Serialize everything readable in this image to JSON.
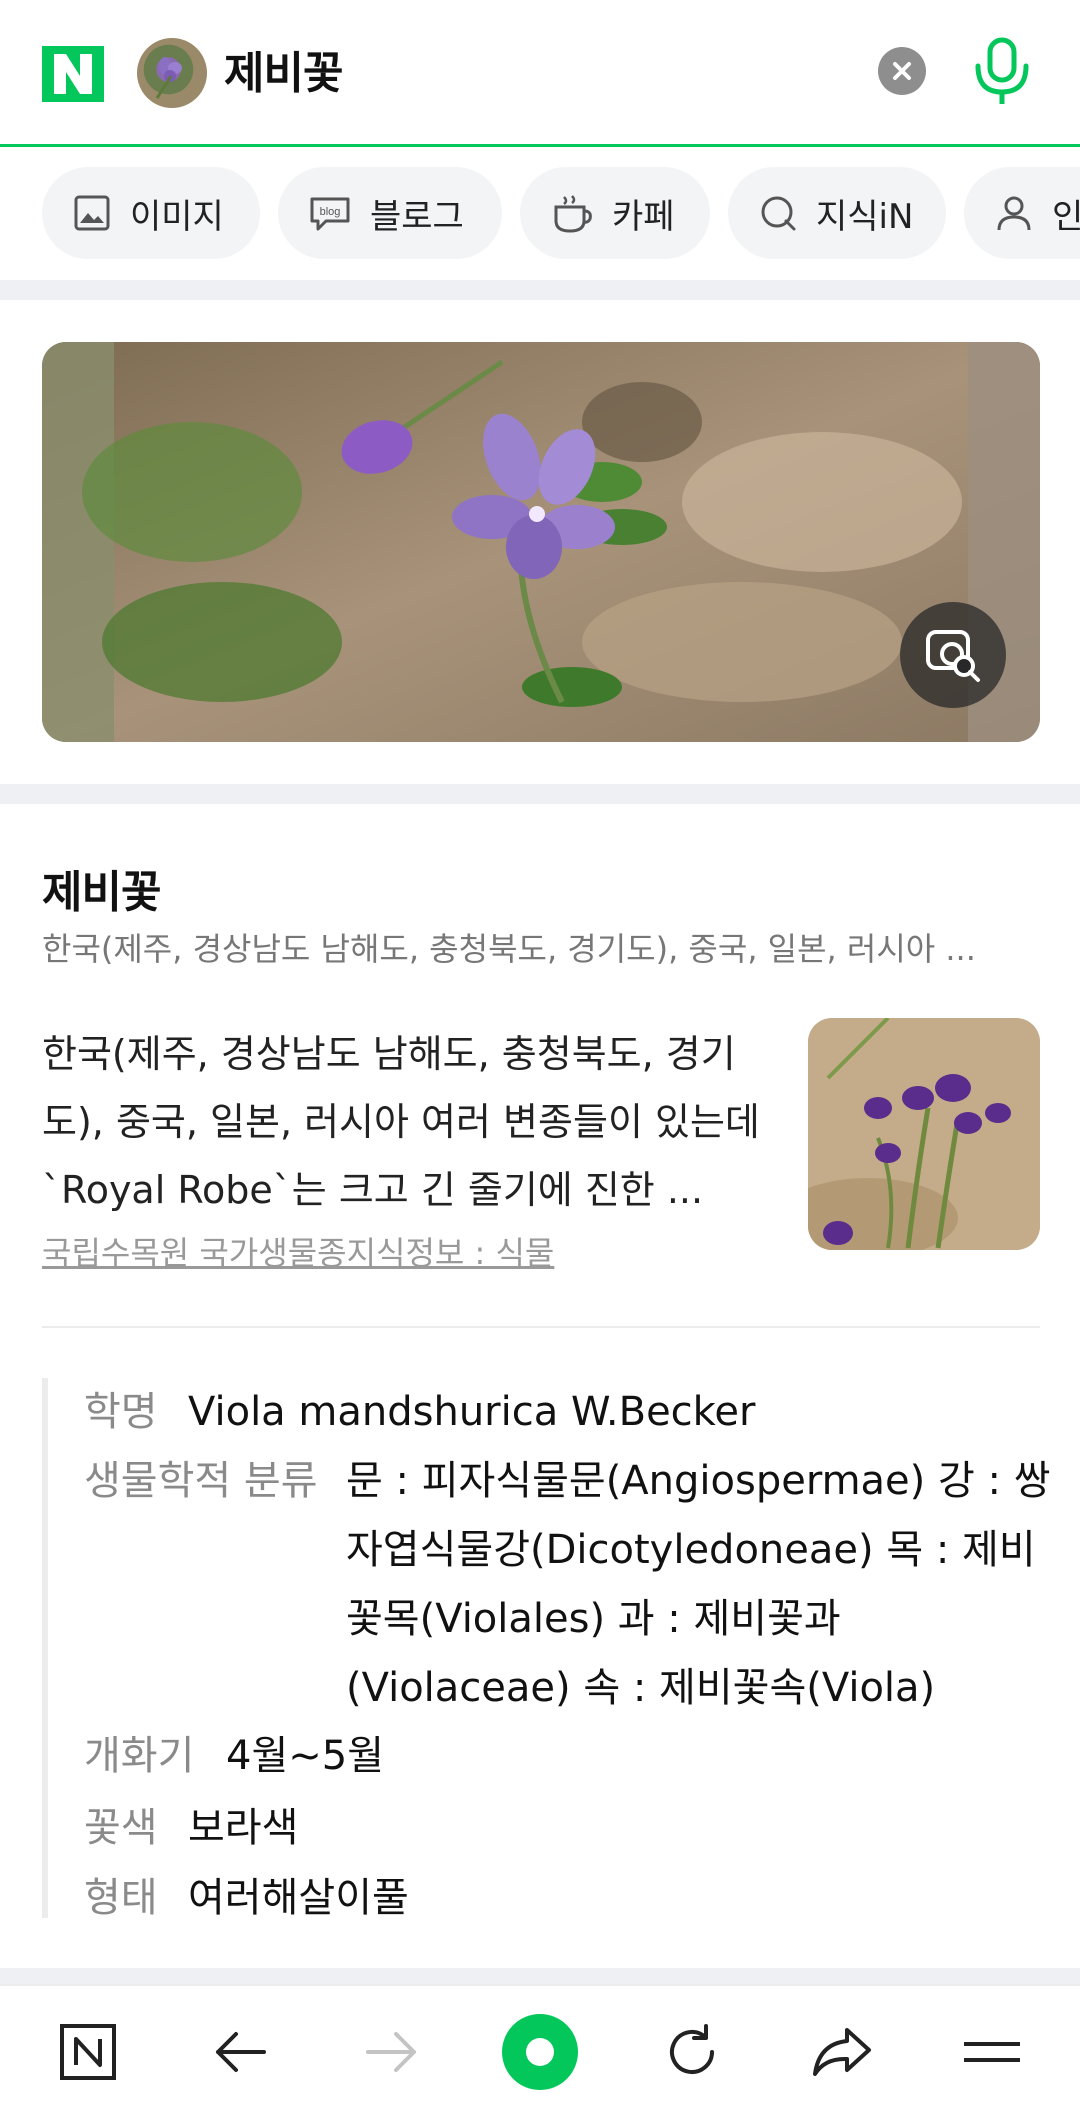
{
  "header": {
    "logo": "N",
    "query": "제비꽃",
    "icons": [
      "naver-logo",
      "thumbnail",
      "clear-icon",
      "mic-icon"
    ]
  },
  "chips": [
    {
      "label": "이미지",
      "icon": "image-icon"
    },
    {
      "label": "블로그",
      "icon": "blog-icon"
    },
    {
      "label": "카페",
      "icon": "cafe-icon"
    },
    {
      "label": "지식iN",
      "icon": "knowledge-icon"
    },
    {
      "label": "인",
      "icon": "person-icon"
    }
  ],
  "result": {
    "title": "제비꽃",
    "subtitle": "한국(제주, 경상남도 남해도, 충청북도, 경기도), 중국, 일본, 러시아 ...",
    "description": "한국(제주, 경상남도 남해도, 충청북도, 경기도), 중국, 일본, 러시아 여러 변종들이 있는데 `Royal Robe`는 크고 긴 줄기에 진한 ...",
    "source": "국립수목원 국가생물종지식정보 : 식물"
  },
  "info": {
    "scientific_label": "학명",
    "scientific_value": "Viola mandshurica W.Becker",
    "taxonomy_label": "생물학적 분류",
    "taxonomy_lines": [
      "문 : 피자식물문(Angiospermae) 강 : 쌍",
      "자엽식물강(Dicotyledoneae) 목 : 제비",
      "꽃목(Violales) 과 : 제비꽃과",
      "(Violaceae) 속 : 제비꽃속(Viola)"
    ],
    "bloom_label": "개화기",
    "bloom_value": "4월~5월",
    "color_label": "꽃색",
    "color_value": "보라색",
    "form_label": "형태",
    "form_value": "여러해살이풀"
  },
  "bottom_nav": [
    "naver-home-icon",
    "back-icon",
    "forward-icon",
    "green-dot-icon",
    "refresh-icon",
    "share-icon",
    "menu-icon"
  ],
  "colors": {
    "brand": "#03c75a",
    "label": "#8a8a8a",
    "chip_bg": "#f3f4f6"
  }
}
